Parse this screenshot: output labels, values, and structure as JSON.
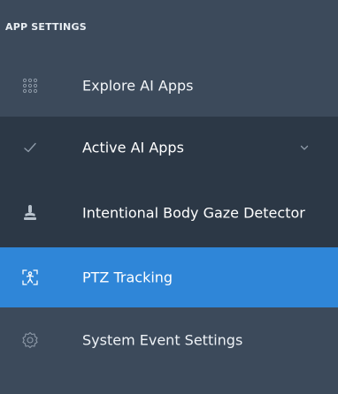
{
  "section": {
    "title": "APP SETTINGS"
  },
  "items": [
    {
      "label": "Explore AI Apps",
      "icon": "grid-dots-icon"
    },
    {
      "label": "Active AI Apps",
      "icon": "check-icon",
      "expander_icon": "chevron-down-icon"
    },
    {
      "label": "Intentional Body Gaze Detector",
      "icon": "person-pin-icon"
    },
    {
      "label": "PTZ Tracking",
      "icon": "tracking-person-icon"
    },
    {
      "label": "System Event Settings",
      "icon": "gear-icon"
    }
  ],
  "colors": {
    "sidebar_bg": "#3c4a5b",
    "submenu_bg": "#2c3846",
    "selected_bg": "#2f86d8",
    "text": "#ffffff",
    "icon_muted": "#8e9aa8"
  }
}
